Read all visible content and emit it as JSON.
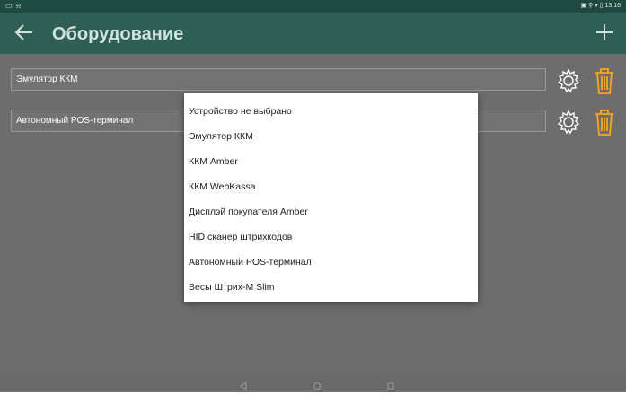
{
  "statusbar": {
    "left_icons": "▭ ⍾",
    "right_text": "▣ ⚲ ▾ ▯ 13:16"
  },
  "toolbar": {
    "title": "Оборудование",
    "back_icon": "arrow-left-icon",
    "add_icon": "plus-icon"
  },
  "devices": [
    {
      "value": "Эмулятор ККМ"
    },
    {
      "value": "Автономный POS-терминал"
    }
  ],
  "dropdown": {
    "options": [
      "Устройство не выбрано",
      "Эмулятор ККМ",
      "ККМ Amber",
      "ККМ WebKassa",
      "Дисплэй покупателя Amber",
      "HID сканер штрихкодов",
      "Автономный POS-терминал",
      "Весы Штрих-М Slim"
    ]
  },
  "colors": {
    "toolbar": "#2f5e54",
    "statusbar": "#1f4a41",
    "accent_trash": "#f5a623",
    "gear": "#ffffff"
  }
}
